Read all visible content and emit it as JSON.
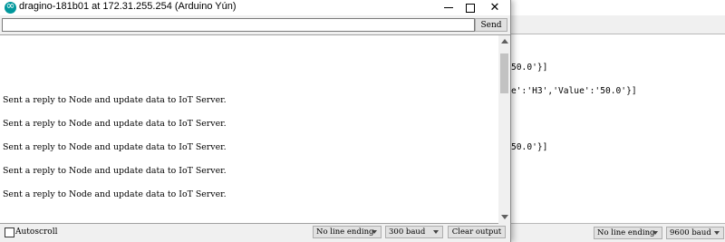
{
  "window": {
    "title": "dragino-181b01 at 172.31.255.254 (Arduino Yún)",
    "icon": "arduino-logo-icon",
    "controls": {
      "minimize": "minimize-icon",
      "maximize": "maximize-icon",
      "close": "✕"
    }
  },
  "send": {
    "input_value": "",
    "button_label": "Send"
  },
  "output": {
    "lines": [
      "Sent a reply to Node and update data to IoT Server.",
      "Sent a reply to Node and update data to IoT Server.",
      "Sent a reply to Node and update data to IoT Server.",
      "Sent a reply to Node and update data to IoT Server.",
      "Sent a reply to Node and update data to IoT Server."
    ]
  },
  "bottom": {
    "autoscroll_label": "Autoscroll",
    "autoscroll_checked": false,
    "line_ending": "No line ending",
    "baud": "300 baud",
    "clear_label": "Clear output"
  },
  "background_window": {
    "output_fragments": [
      "50.0'}]",
      "e':'H3','Value':'50.0'}]",
      "50.0'}]"
    ],
    "line_ending": "No line ending",
    "baud": "9600 baud"
  },
  "colors": {
    "accent": "#00979c",
    "output_bg": "#ffffff",
    "chrome_bg": "#f0f0f0"
  }
}
